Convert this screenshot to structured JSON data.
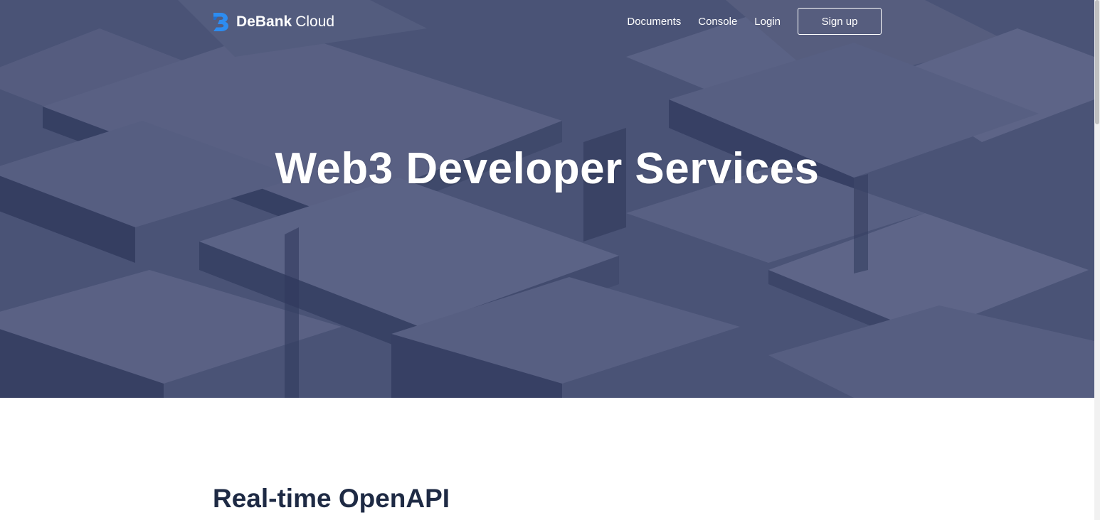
{
  "colors": {
    "hero_background": "#4b5576",
    "brand_blue": "#2d8cf0",
    "heading_dark": "#1e2a44"
  },
  "header": {
    "logo": {
      "icon": "debank-logo-icon",
      "brand": "DeBank",
      "suffix": "Cloud"
    },
    "nav": {
      "documents": "Documents",
      "console": "Console",
      "login": "Login",
      "signup": "Sign up"
    }
  },
  "hero": {
    "title": "Web3 Developer Services"
  },
  "main": {
    "section_title": "Real-time OpenAPI"
  }
}
